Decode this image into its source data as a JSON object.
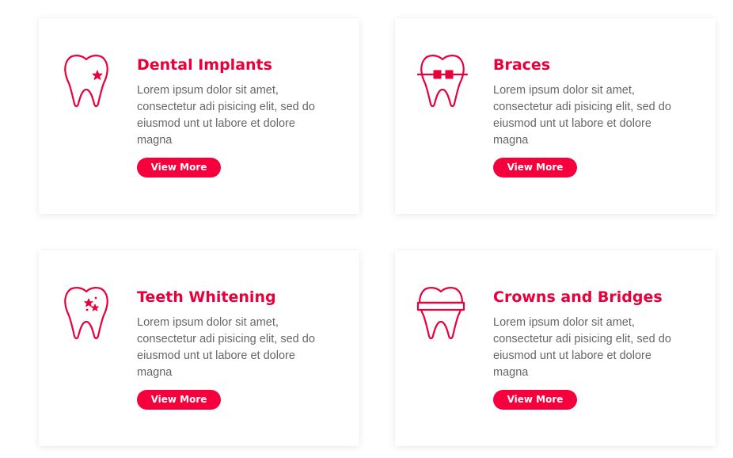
{
  "accent_color": "#e8003b",
  "services": [
    {
      "title": "Dental Implants",
      "description": "Lorem ipsum dolor sit amet, consectetur adi pisicing elit, sed do eiusmod unt ut labore et dolore magna",
      "button_label": "View More",
      "icon": "tooth-star-icon"
    },
    {
      "title": "Braces",
      "description": "Lorem ipsum dolor sit amet, consectetur adi pisicing elit, sed do eiusmod unt ut labore et dolore magna",
      "button_label": "View More",
      "icon": "tooth-braces-icon"
    },
    {
      "title": "Teeth Whitening",
      "description": "Lorem ipsum dolor sit amet, consectetur adi pisicing elit, sed do eiusmod unt ut labore et dolore magna",
      "button_label": "View More",
      "icon": "tooth-sparkle-icon"
    },
    {
      "title": "Crowns and Bridges",
      "description": "Lorem ipsum dolor sit amet, consectetur adi pisicing elit, sed do eiusmod unt ut labore et dolore magna",
      "button_label": "View More",
      "icon": "tooth-crown-icon"
    }
  ]
}
